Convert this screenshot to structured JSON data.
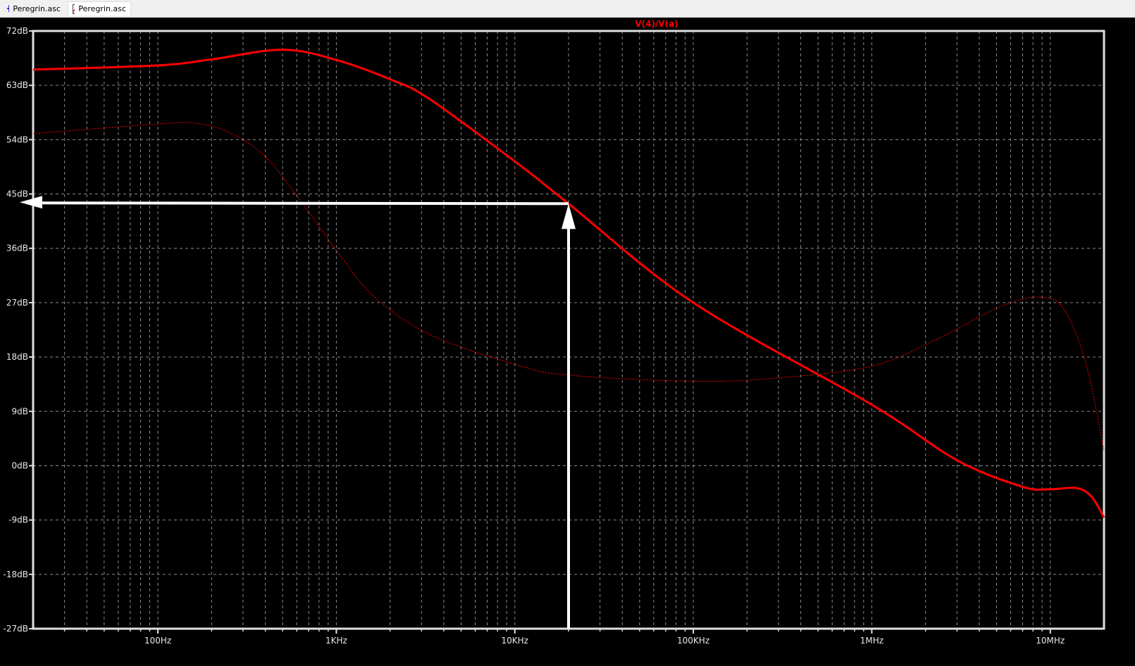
{
  "tabs": [
    {
      "label": "Peregrin.asc",
      "icon": "schematic-transistor-icon",
      "active": false
    },
    {
      "label": "Peregrin.asc",
      "icon": "waveform-plot-icon",
      "active": true
    }
  ],
  "colors": {
    "background": "#000000",
    "axis": "#e0e0e0",
    "grid": "#808080",
    "trace": "#ff0000",
    "annotation": "#ffffff"
  },
  "chart_data": {
    "type": "line",
    "title": "V(4)/V(a)",
    "xscale": "log",
    "xlim": [
      20,
      20000000
    ],
    "ylim": [
      -27,
      72
    ],
    "grid": true,
    "xticks": [
      {
        "value": 100,
        "label": "100Hz"
      },
      {
        "value": 1000,
        "label": "1KHz"
      },
      {
        "value": 10000,
        "label": "10KHz"
      },
      {
        "value": 100000,
        "label": "100KHz"
      },
      {
        "value": 1000000,
        "label": "1MHz"
      },
      {
        "value": 10000000,
        "label": "10MHz"
      }
    ],
    "yticks": [
      {
        "value": 72,
        "label": "72dB"
      },
      {
        "value": 63,
        "label": "63dB"
      },
      {
        "value": 54,
        "label": "54dB"
      },
      {
        "value": 45,
        "label": "45dB"
      },
      {
        "value": 36,
        "label": "36dB"
      },
      {
        "value": 27,
        "label": "27dB"
      },
      {
        "value": 18,
        "label": "18dB"
      },
      {
        "value": 9,
        "label": "9dB"
      },
      {
        "value": 0,
        "label": "0dB"
      },
      {
        "value": -9,
        "label": "-9dB"
      },
      {
        "value": -18,
        "label": "-18dB"
      },
      {
        "value": -27,
        "label": "-27dB"
      }
    ],
    "series": [
      {
        "style": "solid",
        "x": [
          20,
          100,
          200,
          500,
          1000,
          2000,
          3300,
          10000,
          20000,
          100000,
          1000000,
          3000000,
          7000000,
          10000000,
          14000000,
          17000000,
          20000000
        ],
        "y": [
          65.6,
          66.3,
          67.3,
          68.9,
          67.2,
          64.0,
          60.8,
          50.4,
          43.4,
          27.0,
          10.1,
          0.9,
          -3.5,
          -3.9,
          -3.7,
          -5.1,
          -8.6
        ]
      },
      {
        "style": "dashed",
        "x": [
          20,
          100,
          165,
          260,
          410,
          650,
          1000,
          1600,
          3300,
          10000,
          20000,
          100000,
          290000,
          1000000,
          2300000,
          5300000,
          8800000,
          12000000,
          16000000,
          20000000
        ],
        "y": [
          55.0,
          56.6,
          56.7,
          55.0,
          50.9,
          43.3,
          35.7,
          28.2,
          21.8,
          16.8,
          15.0,
          14.0,
          14.5,
          16.5,
          20.9,
          26.4,
          27.9,
          25.8,
          16.5,
          2.5
        ]
      }
    ],
    "annotations": [
      {
        "type": "arrows-to-axes",
        "x": 20000,
        "y": 43.4
      }
    ]
  }
}
